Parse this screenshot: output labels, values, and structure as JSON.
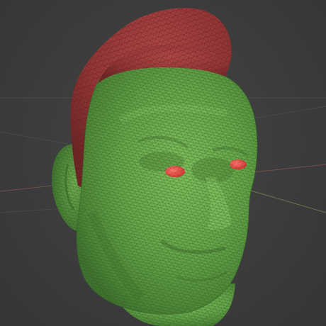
{
  "viewport": {
    "view": "3d-perspective",
    "background_color": "#3c3c3c",
    "grid_color": "#4f4f4f",
    "x_axis_color": "#9a5a5a",
    "y_axis_color": "#8a9a5a"
  },
  "mesh": {
    "object": "head-sculpt",
    "display_mode": "wireframe-on-shaded",
    "face_groups": [
      {
        "name": "skin",
        "color": "#6cab4e"
      },
      {
        "name": "hair",
        "color": "#9c3a3a"
      },
      {
        "name": "eyes",
        "color": "#e0463e"
      }
    ],
    "wire_color": "#2c4a22"
  }
}
